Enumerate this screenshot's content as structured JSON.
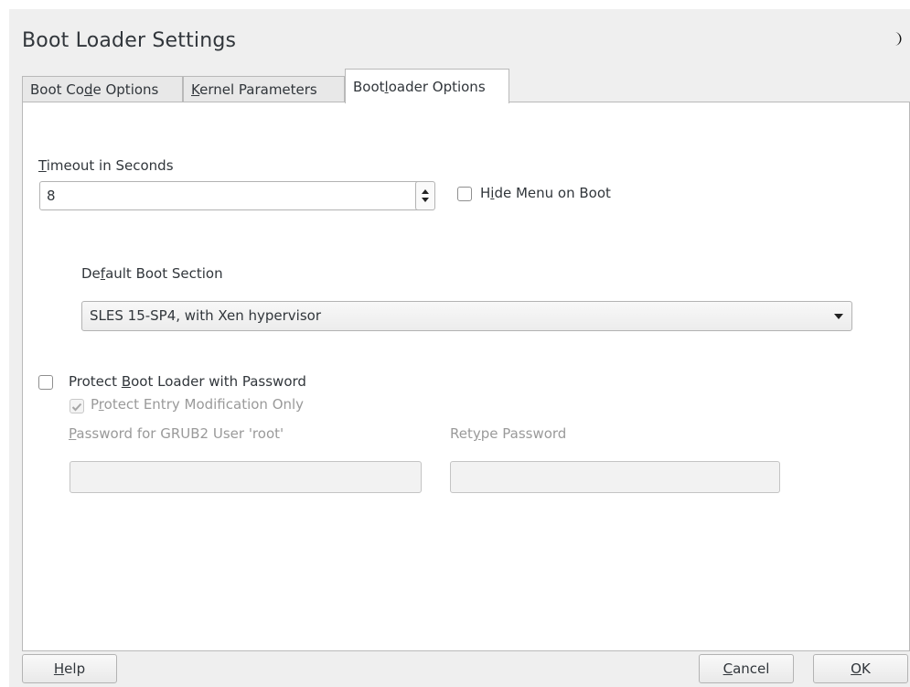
{
  "window": {
    "title": "Boot Loader Settings"
  },
  "tabs": [
    {
      "pre": "Boot Co",
      "mn": "d",
      "post": "e Options"
    },
    {
      "pre": "",
      "mn": "K",
      "post": "ernel Parameters"
    },
    {
      "pre": "Boot",
      "mn": "l",
      "post": "oader Options"
    }
  ],
  "timeout": {
    "pre": "",
    "mn": "T",
    "post": "imeout in Seconds",
    "value": "8"
  },
  "hide_menu": {
    "pre": "H",
    "mn": "i",
    "post": "de Menu on Boot",
    "checked": false
  },
  "default_section": {
    "pre": "De",
    "mn": "f",
    "post": "ault Boot Section",
    "selected": "SLES 15-SP4, with Xen hypervisor"
  },
  "protect": {
    "pre": "Protect ",
    "mn": "B",
    "post": "oot Loader with Password",
    "checked": false
  },
  "protect_entry": {
    "pre": "P",
    "mn": "r",
    "post": "otect Entry Modification Only",
    "checked": true
  },
  "password": {
    "pre": "",
    "mn": "P",
    "post": "assword for GRUB2 User 'root'",
    "value": ""
  },
  "retype": {
    "pre": "Ret",
    "mn": "y",
    "post": "pe Password",
    "value": ""
  },
  "buttons": {
    "help": {
      "pre": "",
      "mn": "H",
      "post": "elp"
    },
    "cancel": {
      "pre": "",
      "mn": "C",
      "post": "ancel"
    },
    "ok": {
      "pre": "",
      "mn": "O",
      "post": "K"
    }
  },
  "colors": {
    "accent": "#3daee9",
    "text": "#31363b",
    "disabled": "#9a9a9a"
  }
}
